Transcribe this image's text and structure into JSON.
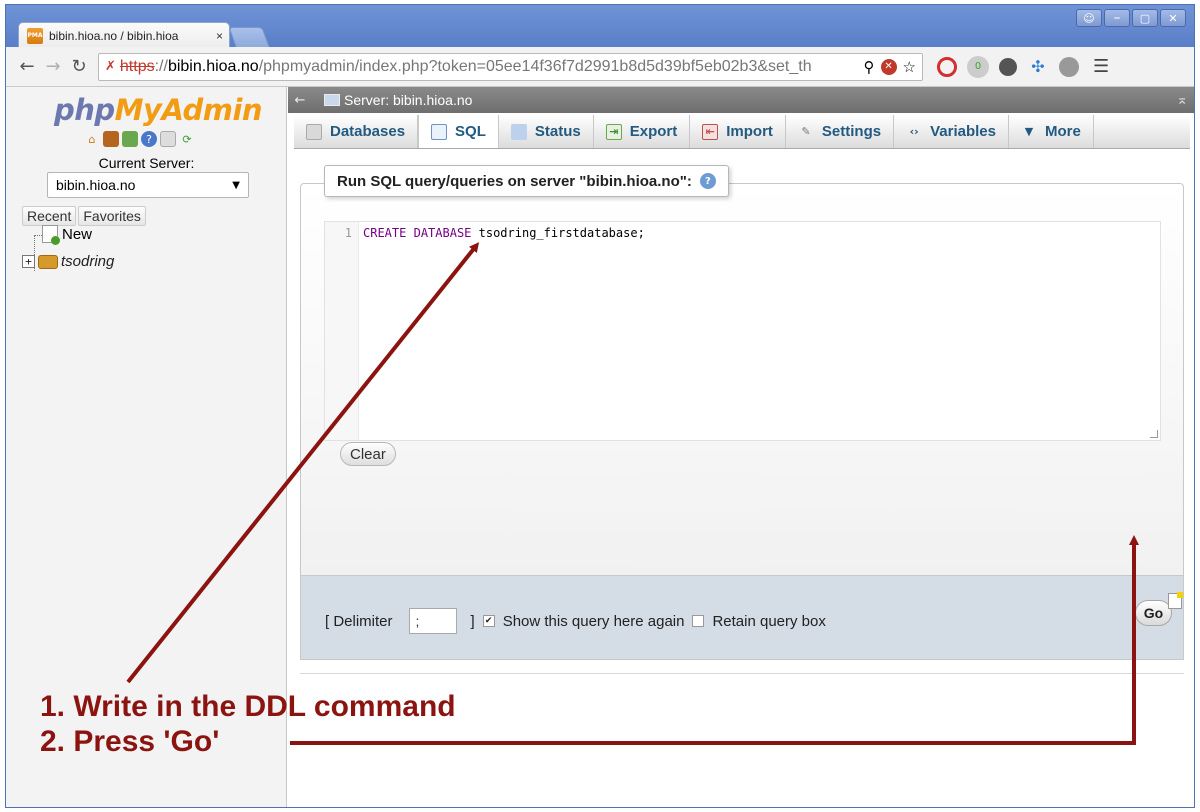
{
  "browser": {
    "tab_title": "bibin.hioa.no / bibin.hioa",
    "tab_close": "×",
    "favicon_text": "PMA",
    "url_scheme": "https",
    "url_sep": "://",
    "url_host": "bibin.hioa.no",
    "url_rest": "/phpmyadmin/index.php?token=05ee14f36f7d2991b8d5d39bf5eb02b3&set_th",
    "window_buttons": [
      "⎯",
      "▢",
      "✕"
    ]
  },
  "pma_nav": {
    "logo": {
      "php": "php",
      "my": "My",
      "admin": "Admin"
    },
    "current_server_label": "Current Server:",
    "server_value": "bibin.hioa.no",
    "recent_label": "Recent",
    "favorites_label": "Favorites",
    "tree_new": "New",
    "tree_db": "tsodring",
    "expander": "+"
  },
  "main": {
    "server_bar_label": "Server: bibin.hioa.no",
    "tabs": [
      {
        "label": "Databases"
      },
      {
        "label": "SQL"
      },
      {
        "label": "Status"
      },
      {
        "label": "Export"
      },
      {
        "label": "Import"
      },
      {
        "label": "Settings"
      },
      {
        "label": "Variables"
      },
      {
        "label": "More"
      }
    ],
    "active_tab": "SQL",
    "legend": "Run SQL query/queries on server \"bibin.hioa.no\":",
    "editor": {
      "line_number": "1",
      "keyword1": "CREATE",
      "keyword2": "DATABASE",
      "identifier": "tsodring_firstdatabase;"
    },
    "clear_label": "Clear",
    "delimiter_label": "[ Delimiter",
    "delimiter_value": ";",
    "delimiter_close": "]",
    "show_query_label": "Show this query here again",
    "show_query_checked": true,
    "retain_box_label": "Retain query box",
    "retain_box_checked": false,
    "go_label": "Go"
  },
  "annotations": {
    "step1": "1. Write in the DDL command",
    "step2": "2. Press 'Go'",
    "color": "#8b1410"
  },
  "colors": {
    "tab_text": "#235a81",
    "sql_keyword": "#770088",
    "logo_php": "#6c78af",
    "logo_myadmin": "#f29c13"
  }
}
